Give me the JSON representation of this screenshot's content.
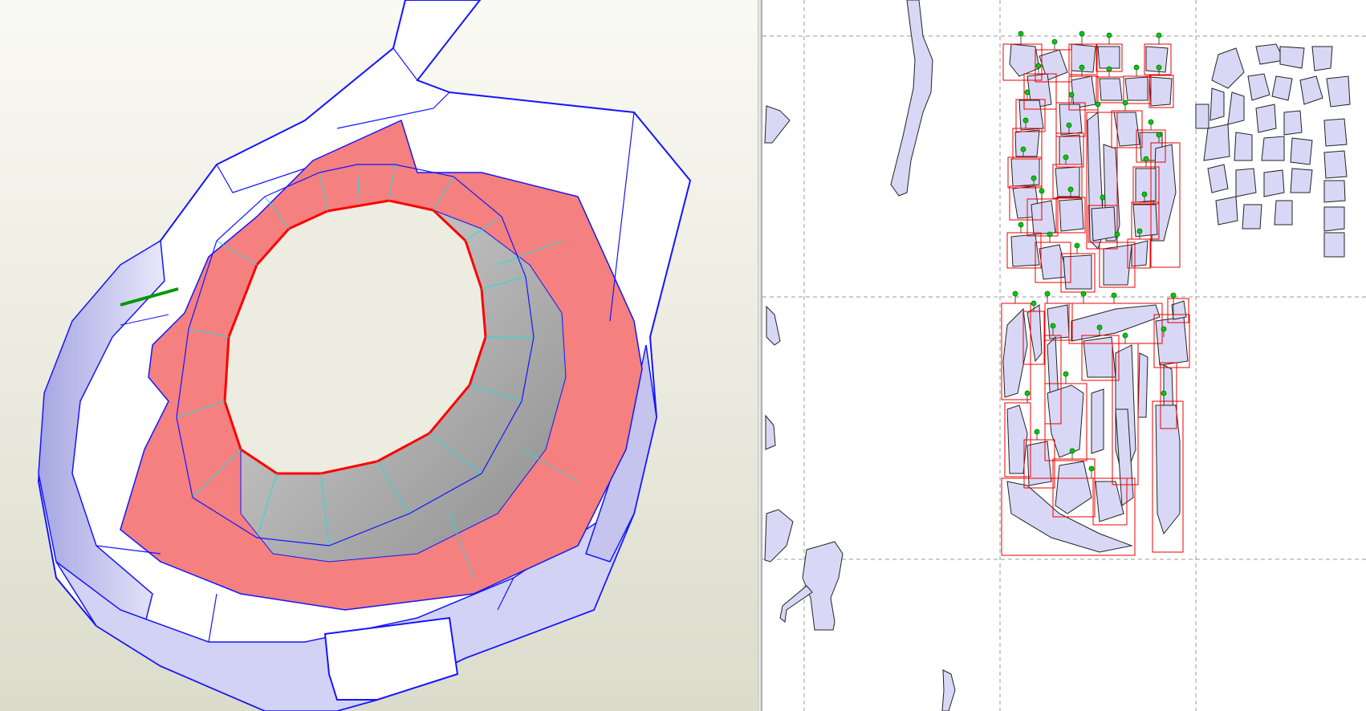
{
  "app": {
    "window_title": "",
    "panes": {
      "left": "3d-model-view",
      "right": "2d-unfold-layout"
    }
  },
  "colors": {
    "viewport_bg_top": "#fafaf4",
    "viewport_bg_bottom": "#ddddce",
    "mesh_face": "#ffffff",
    "mesh_shade": "#b9b9ec",
    "mesh_inner": "#bdbdbd",
    "selected_face": "#f08080",
    "mesh_edge": "#1515ff",
    "fold_edge": "#22dddd",
    "selected_edge": "#ff0000",
    "axis_marker": "#009900",
    "part_fill": "#d8d8f6",
    "part_outline": "#222222",
    "selection_box": "#ee0000",
    "pin_marker": "#00cc00",
    "page_grid": "#999999"
  },
  "icons": {
    "axis": "axis-indicator-icon",
    "pin": "pin-marker-icon"
  }
}
